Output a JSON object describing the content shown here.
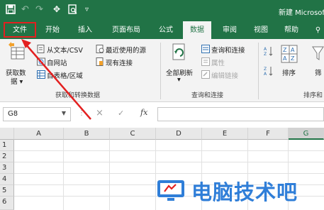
{
  "app": {
    "title": "新建 Microsoft",
    "accent": "#217346",
    "highlight": "#e32020"
  },
  "quick_access": {
    "icons": [
      "save-icon",
      "undo-icon",
      "redo-icon",
      "touch-mode-icon",
      "print-preview-icon",
      "customize-dropdown-icon"
    ]
  },
  "tabs": [
    {
      "label": "文件",
      "active": false
    },
    {
      "label": "开始",
      "active": false
    },
    {
      "label": "插入",
      "active": false
    },
    {
      "label": "页面布局",
      "active": false
    },
    {
      "label": "公式",
      "active": false
    },
    {
      "label": "数据",
      "active": true
    },
    {
      "label": "审阅",
      "active": false
    },
    {
      "label": "视图",
      "active": false
    },
    {
      "label": "帮助",
      "active": false
    }
  ],
  "ribbon": {
    "get_data": {
      "line1": "获取数",
      "line2": "据 ▾"
    },
    "from_text_csv": "从文本/CSV",
    "from_web": "自网站",
    "from_table": "自表格/区域",
    "recent_sources": "最近使用的源",
    "existing_connections": "现有连接",
    "group_get_transform": "获取和转换数据",
    "refresh_all": "全部刷新",
    "refresh_all_arrow": "▾",
    "queries_connections": "查询和连接",
    "properties": "属性",
    "edit_links": "编辑链接",
    "group_queries": "查询和连接",
    "sort": "排序",
    "filter": "筛",
    "group_sort_filter": "排序和"
  },
  "formula_bar": {
    "name_box": "G8",
    "cancel": "×",
    "enter": "✓",
    "fx": "fx"
  },
  "sheet": {
    "columns": [
      "A",
      "B",
      "C",
      "D",
      "E",
      "F",
      "G"
    ],
    "selected_column": "G",
    "rows": [
      "1",
      "2",
      "3",
      "4",
      "5",
      "6"
    ]
  },
  "watermark": {
    "text": "电脑技术吧"
  }
}
